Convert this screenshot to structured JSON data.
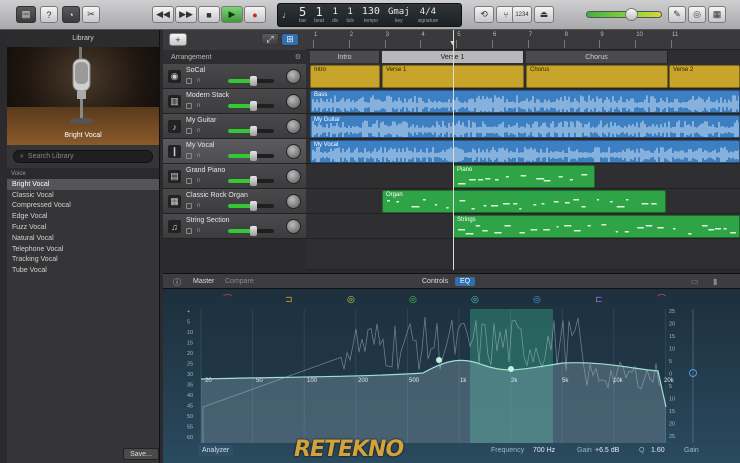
{
  "toolbar": {
    "lcd": {
      "bar": "5",
      "beat": "1",
      "div": "1",
      "tick": "1",
      "bar_label": "bar",
      "beat_label": "beat",
      "div_label": "div",
      "tick_label": "tick",
      "tempo": "130",
      "tempo_label": "tempo",
      "key": "Gmaj",
      "key_label": "key",
      "signature": "4/4",
      "signature_label": "signature",
      "counter": "1234"
    },
    "volume_level": 0.58
  },
  "library": {
    "title": "Library",
    "preview_label": "Bright Vocal",
    "search_placeholder": "Search Library",
    "category": "Voice",
    "items": [
      "Bright Vocal",
      "Classic Vocal",
      "Compressed Vocal",
      "Edge Vocal",
      "Fuzz Vocal",
      "Natural Vocal",
      "Telephone Vocal",
      "Tracking Vocal",
      "Tube Vocal"
    ],
    "selected": 0,
    "save_label": "Save..."
  },
  "arrangement_label": "Arrangement",
  "tracks": [
    {
      "name": "SoCal",
      "icon": "drum-icon"
    },
    {
      "name": "Modern Stack",
      "icon": "amp-icon"
    },
    {
      "name": "My Guitar",
      "icon": "guitar-icon"
    },
    {
      "name": "My Vocal",
      "icon": "microphone-icon"
    },
    {
      "name": "Grand Piano",
      "icon": "piano-icon"
    },
    {
      "name": "Classic Rock Organ",
      "icon": "organ-icon"
    },
    {
      "name": "String Section",
      "icon": "violin-icon"
    }
  ],
  "ruler_ticks": [
    "1",
    "2",
    "3",
    "4",
    "5",
    "6",
    "7",
    "8",
    "9",
    "10",
    "11"
  ],
  "sections": [
    "Intro",
    "Verse 1",
    "Chorus"
  ],
  "regions": {
    "socal": [
      "Intro",
      "Verse 1",
      "Chorus",
      "Verse 2"
    ],
    "bass": "Bass",
    "guitar": "My Guitar",
    "vocal": "My Vocal",
    "piano": "Piano",
    "organ": "Organ",
    "strings": "Strings"
  },
  "eq": {
    "tabs": [
      "Master",
      "Compare",
      "Controls",
      "EQ"
    ],
    "freq_labels": [
      "20",
      "50",
      "100",
      "200",
      "500",
      "1k",
      "2k",
      "5k",
      "10k",
      "20k"
    ],
    "db_labels_left": [
      "+",
      "5",
      "10",
      "15",
      "20",
      "25",
      "30",
      "35",
      "40",
      "45",
      "50",
      "55",
      "60"
    ],
    "db_labels_right": [
      "25",
      "20",
      "15",
      "10",
      "5",
      "0",
      "5",
      "10",
      "15",
      "20",
      "25"
    ],
    "analyzer": "Analyzer",
    "frequency_label": "Frequency",
    "frequency_value": "700 Hz",
    "gain_label": "Gain",
    "gain_value": "+6.5 dB",
    "q_label": "Q",
    "q_value": "1.60",
    "gain_right": "Gain"
  },
  "logo": "RETEKNO",
  "colors": {
    "socal_region": "#c8a42a",
    "audio_region": "#3c7fc3",
    "midi_region": "#2fa446",
    "eq_curve": "#9fe0d0"
  }
}
